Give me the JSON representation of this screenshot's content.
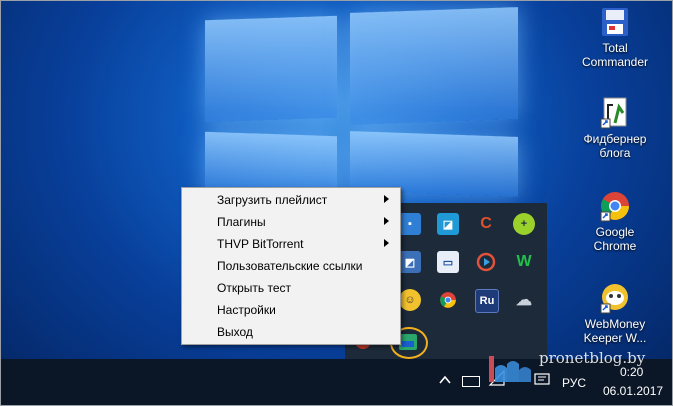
{
  "desktop": {
    "icons": [
      {
        "label": "Total\nCommander",
        "icon": "total-commander-icon",
        "color": "#3a6fd8"
      },
      {
        "label": "Фидбернер\nблога",
        "icon": "feedburner-shortcut-icon",
        "color": "#ffffff"
      },
      {
        "label": "Google\nChrome",
        "icon": "chrome-icon",
        "color": "#4285f4"
      },
      {
        "label": "WebMoney\nKeeper W...",
        "icon": "webmoney-icon",
        "color": "#f2c12e"
      }
    ]
  },
  "context_menu": {
    "items": [
      {
        "label": "Загрузить плейлист",
        "submenu": true
      },
      {
        "label": "Плагины",
        "submenu": true
      },
      {
        "label": "THVP BitTorrent",
        "submenu": true
      },
      {
        "label": "Пользовательские ссылки",
        "submenu": false
      },
      {
        "label": "Открыть тест",
        "submenu": false
      },
      {
        "label": "Настройки",
        "submenu": false
      },
      {
        "label": "Выход",
        "submenu": false
      }
    ]
  },
  "tray_overflow": {
    "icons": [
      "tray-app-icon-1",
      "tray-app-icon-2",
      "tray-ccleaner-icon",
      "tray-plus-icon",
      "tray-app-icon-5",
      "tray-window-icon",
      "tray-player-icon",
      "tray-w-icon",
      "tray-webmoney-icon",
      "tray-chrome-icon",
      "tray-ru-icon",
      "tray-cloud-icon",
      "tray-red-icon",
      "tray-highlighted-player-icon"
    ],
    "ru_label": "Ru",
    "w_label": "W"
  },
  "taskbar": {
    "language": "РУС",
    "time": "0:20",
    "date": "06.01.2017"
  },
  "watermark": {
    "site": "pronetblog.by"
  },
  "colors": {
    "accent_highlight": "#f2b01e",
    "taskbar": "#0b1626",
    "menu_bg": "#f2f2f2"
  }
}
